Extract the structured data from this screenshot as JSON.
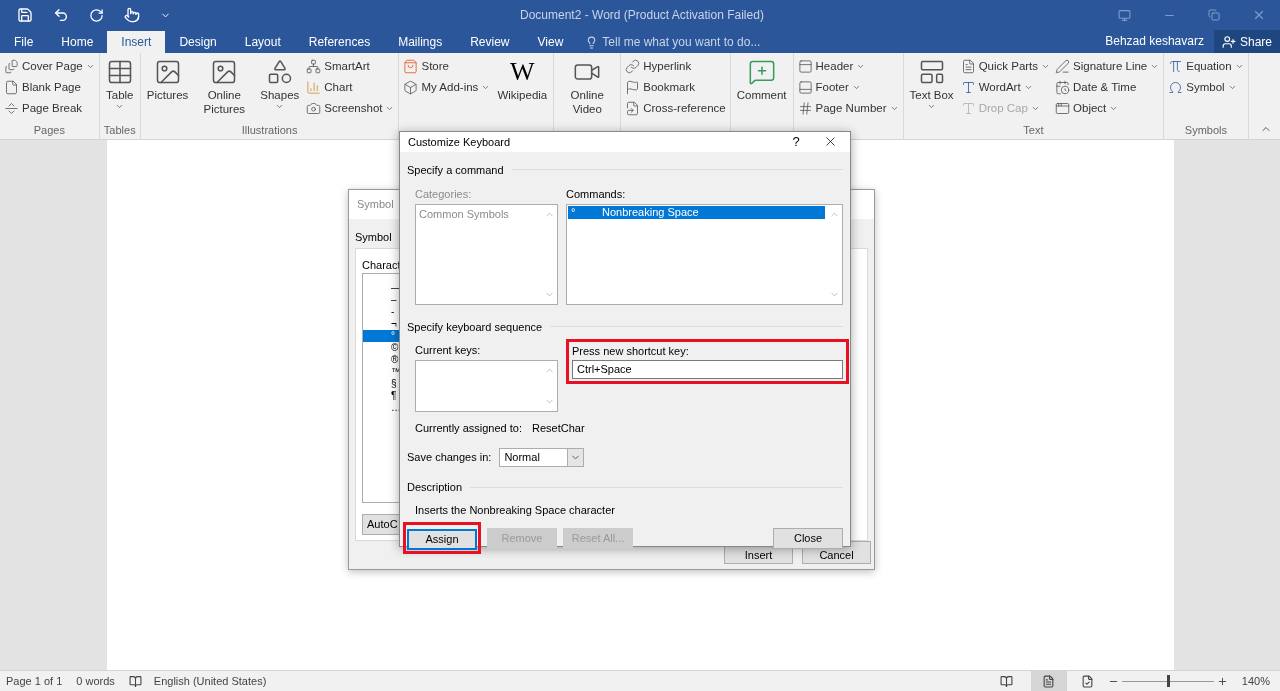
{
  "title": "Document2 - Word (Product Activation Failed)",
  "tabs": [
    {
      "label": "File",
      "selected": false
    },
    {
      "label": "Home",
      "selected": false
    },
    {
      "label": "Insert",
      "selected": true
    },
    {
      "label": "Design",
      "selected": false
    },
    {
      "label": "Layout",
      "selected": false
    },
    {
      "label": "References",
      "selected": false
    },
    {
      "label": "Mailings",
      "selected": false
    },
    {
      "label": "Review",
      "selected": false
    },
    {
      "label": "View",
      "selected": false
    }
  ],
  "tell_me": {
    "placeholder": "Tell me what you want to do..."
  },
  "user": "Behzad keshavarz",
  "share": "Share",
  "ribbon": [
    {
      "label": "Pages",
      "items": [
        {
          "kind": "stack",
          "items": [
            {
              "label": "Cover Page",
              "dropdown": true,
              "disabled": false
            },
            {
              "label": "Blank Page",
              "dropdown": false,
              "disabled": false
            },
            {
              "label": "Page Break",
              "dropdown": false,
              "disabled": false
            }
          ]
        }
      ]
    },
    {
      "label": "Tables",
      "items": [
        {
          "kind": "large",
          "label": "Table",
          "dropdown": true,
          "disabled": false
        }
      ]
    },
    {
      "label": "Illustrations",
      "items": [
        {
          "kind": "large",
          "label": "Pictures",
          "dropdown": false,
          "disabled": false
        },
        {
          "kind": "large",
          "label": "Online Pictures",
          "dropdown": false,
          "disabled": false
        },
        {
          "kind": "large",
          "label": "Shapes",
          "dropdown": true,
          "disabled": false
        },
        {
          "kind": "stack",
          "items": [
            {
              "label": "SmartArt",
              "dropdown": false,
              "disabled": false
            },
            {
              "label": "Chart",
              "dropdown": false,
              "disabled": false
            },
            {
              "label": "Screenshot",
              "dropdown": true,
              "disabled": false
            }
          ]
        }
      ]
    },
    {
      "items": [
        {
          "kind": "stack",
          "items": [
            {
              "label": "Store",
              "dropdown": false,
              "disabled": false
            },
            {
              "label": "My Add-ins",
              "dropdown": true,
              "disabled": false
            }
          ]
        },
        {
          "kind": "large",
          "label": "Wikipedia",
          "glyph": "W",
          "dropdown": false,
          "disabled": false
        }
      ]
    },
    {
      "items": [
        {
          "kind": "large",
          "label": "Online Video",
          "dropdown": false,
          "disabled": false
        }
      ]
    },
    {
      "items": [
        {
          "kind": "stack",
          "items": [
            {
              "label": "Hyperlink",
              "dropdown": false,
              "disabled": false
            },
            {
              "label": "Bookmark",
              "dropdown": false,
              "disabled": false
            },
            {
              "label": "Cross-reference",
              "dropdown": false,
              "disabled": false
            }
          ]
        }
      ]
    },
    {
      "items": [
        {
          "kind": "large",
          "label": "Comment",
          "dropdown": false,
          "disabled": false
        }
      ]
    },
    {
      "items": [
        {
          "kind": "stack",
          "items": [
            {
              "label": "Header",
              "dropdown": true,
              "disabled": false
            },
            {
              "label": "Footer",
              "dropdown": true,
              "disabled": false
            },
            {
              "label": "Page Number",
              "dropdown": true,
              "disabled": false
            }
          ]
        }
      ]
    },
    {
      "label": "Text",
      "items": [
        {
          "kind": "large",
          "label": "Text Box",
          "dropdown": true,
          "disabled": false
        },
        {
          "kind": "stack",
          "items": [
            {
              "label": "Quick Parts",
              "dropdown": true,
              "disabled": false
            },
            {
              "label": "WordArt",
              "dropdown": true,
              "disabled": false
            },
            {
              "label": "Drop Cap",
              "dropdown": true,
              "disabled": true
            }
          ]
        },
        {
          "kind": "stack",
          "items": [
            {
              "label": "Signature Line",
              "dropdown": true,
              "disabled": false
            },
            {
              "label": "Date & Time",
              "dropdown": false,
              "disabled": false
            },
            {
              "label": "Object",
              "dropdown": true,
              "disabled": false
            }
          ]
        }
      ]
    },
    {
      "label": "Symbols",
      "items": [
        {
          "kind": "stack",
          "items": [
            {
              "label": "Equation",
              "dropdown": true,
              "disabled": false
            },
            {
              "label": "Symbol",
              "dropdown": true,
              "disabled": false
            }
          ]
        }
      ]
    }
  ],
  "symbol_dialog": {
    "title": "Symbol",
    "tab": "Symbol",
    "list_label": "Charact",
    "chars": [
      {
        "char": "—",
        "selected": false
      },
      {
        "char": "–",
        "selected": false
      },
      {
        "char": "-",
        "selected": false
      },
      {
        "char": "¬",
        "selected": false
      },
      {
        "char": "°",
        "selected": true
      },
      {
        "char": "©",
        "selected": false
      },
      {
        "char": "®",
        "selected": false
      },
      {
        "char": "™",
        "selected": false
      },
      {
        "char": "§",
        "selected": false
      },
      {
        "char": "¶",
        "selected": false
      },
      {
        "char": "…",
        "selected": false
      }
    ],
    "autocorrect": "AutoC",
    "insert": "Insert",
    "cancel": "Cancel"
  },
  "customize": {
    "title": "Customize Keyboard",
    "help": "?",
    "command_section": "Specify a command",
    "categories": {
      "label": "Categories:",
      "disabled": true,
      "items": [
        "Common Symbols"
      ]
    },
    "commands": {
      "label": "Commands:",
      "items": [
        {
          "symbol": "°",
          "label": "Nonbreaking Space",
          "selected": true
        }
      ]
    },
    "sequence_section": "Specify keyboard sequence",
    "current_keys": {
      "label": "Current keys:"
    },
    "new_key": {
      "label": "Press new shortcut key:",
      "value": "Ctrl+Space",
      "highlighted": true
    },
    "assigned_label": "Currently assigned to:",
    "assigned_value": "ResetChar",
    "save_label": "Save changes in:",
    "save_value": "Normal",
    "description_section": "Description",
    "description": "Inserts the Nonbreaking Space character",
    "buttons": [
      {
        "label": "Assign",
        "disabled": false,
        "highlighted": true
      },
      {
        "label": "Remove",
        "disabled": true,
        "highlighted": false
      },
      {
        "label": "Reset All...",
        "disabled": true,
        "highlighted": false
      },
      {
        "label": "Close",
        "disabled": false,
        "highlighted": false
      }
    ]
  },
  "status_bar": {
    "page": "Page 1 of 1",
    "words": "0 words",
    "language": "English (United States)",
    "zoom": {
      "level": 0.5
    },
    "zoom_label": "140%"
  }
}
